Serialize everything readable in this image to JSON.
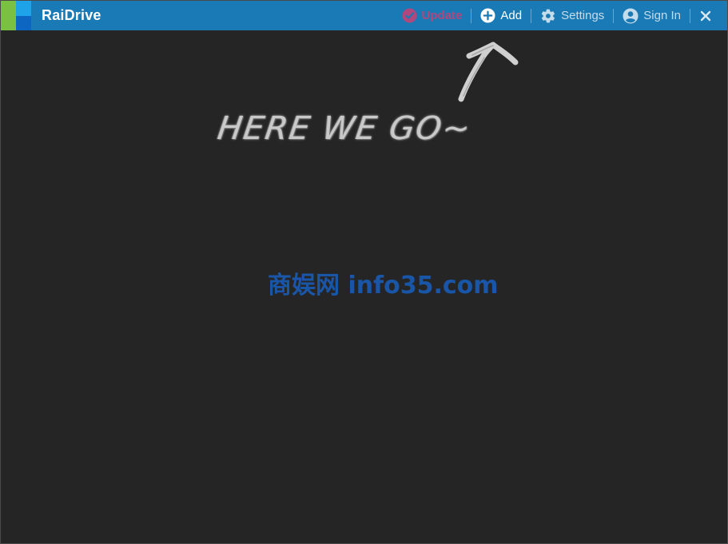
{
  "app": {
    "title": "RaiDrive"
  },
  "toolbar": {
    "update_label": "Update",
    "add_label": "Add",
    "settings_label": "Settings",
    "signin_label": "Sign In",
    "close_icon": "close-icon"
  },
  "content": {
    "hint_text": "HERE WE GO~",
    "watermark": "商娱网 info35.com"
  },
  "colors": {
    "titlebar": "#1a7ab5",
    "background": "#252525",
    "update": "#b0477d",
    "watermark": "#1a56a8"
  }
}
